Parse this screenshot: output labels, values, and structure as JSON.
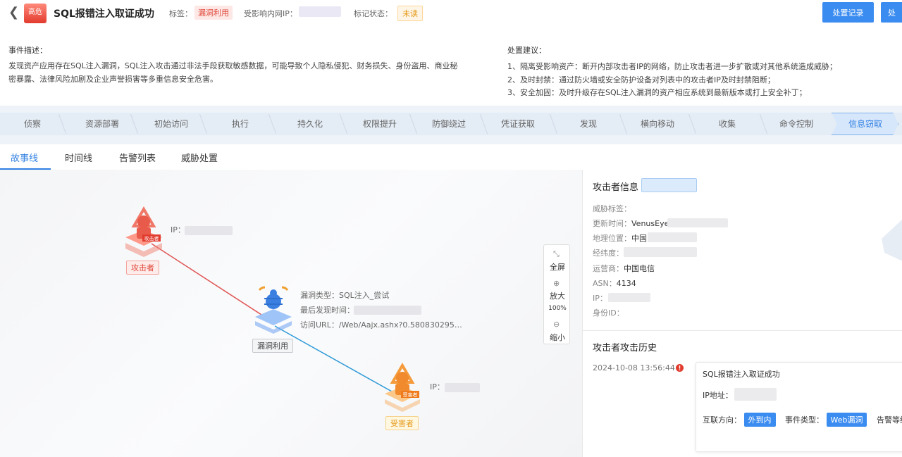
{
  "header": {
    "severity": "高危",
    "title": "SQL报错注入取证成功",
    "tag_label": "标签：",
    "tag_value": "漏洞利用",
    "internal_ip_label": "受影响内网IP：",
    "mark_label": "标记状态：",
    "mark_value": "未读",
    "btn_records": "处置记录",
    "btn_handle": "处"
  },
  "description": {
    "title": "事件描述：",
    "text": "发现资产应用存在SQL注入漏洞，SQL注入攻击通过非法手段获取敏感数据，可能导致个人隐私侵犯、财务损失、身份盗用、商业秘密暴露、法律风险加剧及企业声誉损害等多重信息安全危害。"
  },
  "advice": {
    "title": "处置建议：",
    "items": [
      "1、隔离受影响资产：断开内部攻击者IP的网络，防止攻击者进一步扩散或对其他系统造成威胁；",
      "2、及时封禁：通过防火墙或安全防护设备对列表中的攻击者IP及时封禁阻断；",
      "3、安全加固：及时升级存在SQL注入漏洞的资产相应系统到最新版本或打上安全补丁；"
    ]
  },
  "kill_chain": [
    "侦察",
    "资源部署",
    "初始访问",
    "执行",
    "持久化",
    "权限提升",
    "防御绕过",
    "凭证获取",
    "发现",
    "横向移动",
    "收集",
    "命令控制",
    "信息窃取"
  ],
  "tabs": [
    "故事线",
    "时间线",
    "告警列表",
    "威胁处置"
  ],
  "graph": {
    "attacker_label": "攻击者",
    "attacker_icon_text": "攻击者",
    "attacker_ip_label": "IP：",
    "exploit_label": "漏洞利用",
    "exploit_type": "漏洞类型：SQL注入_尝试",
    "last_seen": "最后发现时间：",
    "visit_url": "访问URL：/Web/Aajx.ashx?0.580830295…",
    "victim_label": "受害者",
    "victim_icon_text": "受害者",
    "victim_ip_label": "IP：",
    "zoom": {
      "full": "全屏",
      "in": "放大",
      "level": "100%",
      "out": "缩小"
    }
  },
  "attacker_info": {
    "title": "攻击者信息",
    "threat_tag": "威胁标签：",
    "update_time": "更新时间：",
    "update_value": "VenusEye:",
    "location": "地理位置：",
    "location_value": "中国",
    "latlng": "经纬度：",
    "isp": "运营商：",
    "isp_value": "中国电信",
    "asn": "ASN：",
    "asn_value": "4134",
    "ip": "IP：",
    "id": "身份ID："
  },
  "history": {
    "title": "攻击者攻击历史",
    "time": "2024-10-08 13:56:44",
    "event_title": "SQL报错注入取证成功",
    "ip_label": "IP地址：",
    "direction_label": "互联方向：",
    "direction_value": "外到内",
    "type_label": "事件类型：",
    "type_value": "Web漏洞",
    "level_label": "告警等级"
  },
  "colors": {
    "primary": "#3b8cf0",
    "danger": "#e0473a",
    "attack_line": "#e05555",
    "victim_line": "#2f9ad8"
  }
}
